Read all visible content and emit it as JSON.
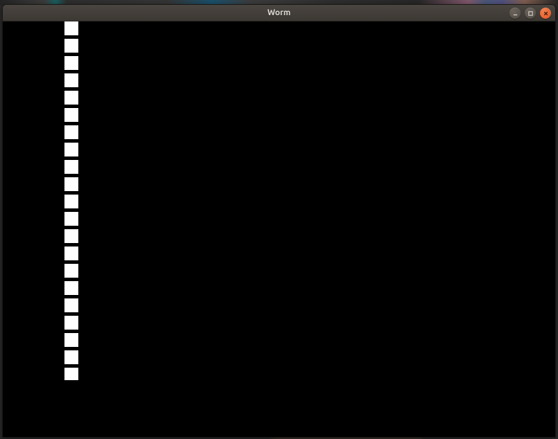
{
  "window": {
    "title": "Worm"
  },
  "worm": {
    "segment_size": 20,
    "gap": 5,
    "x": 89,
    "start_y": 0,
    "count": 21,
    "last_partial_height": 18
  },
  "colors": {
    "segment": "#ffffff",
    "background": "#000000",
    "close_button": "#e95420"
  }
}
